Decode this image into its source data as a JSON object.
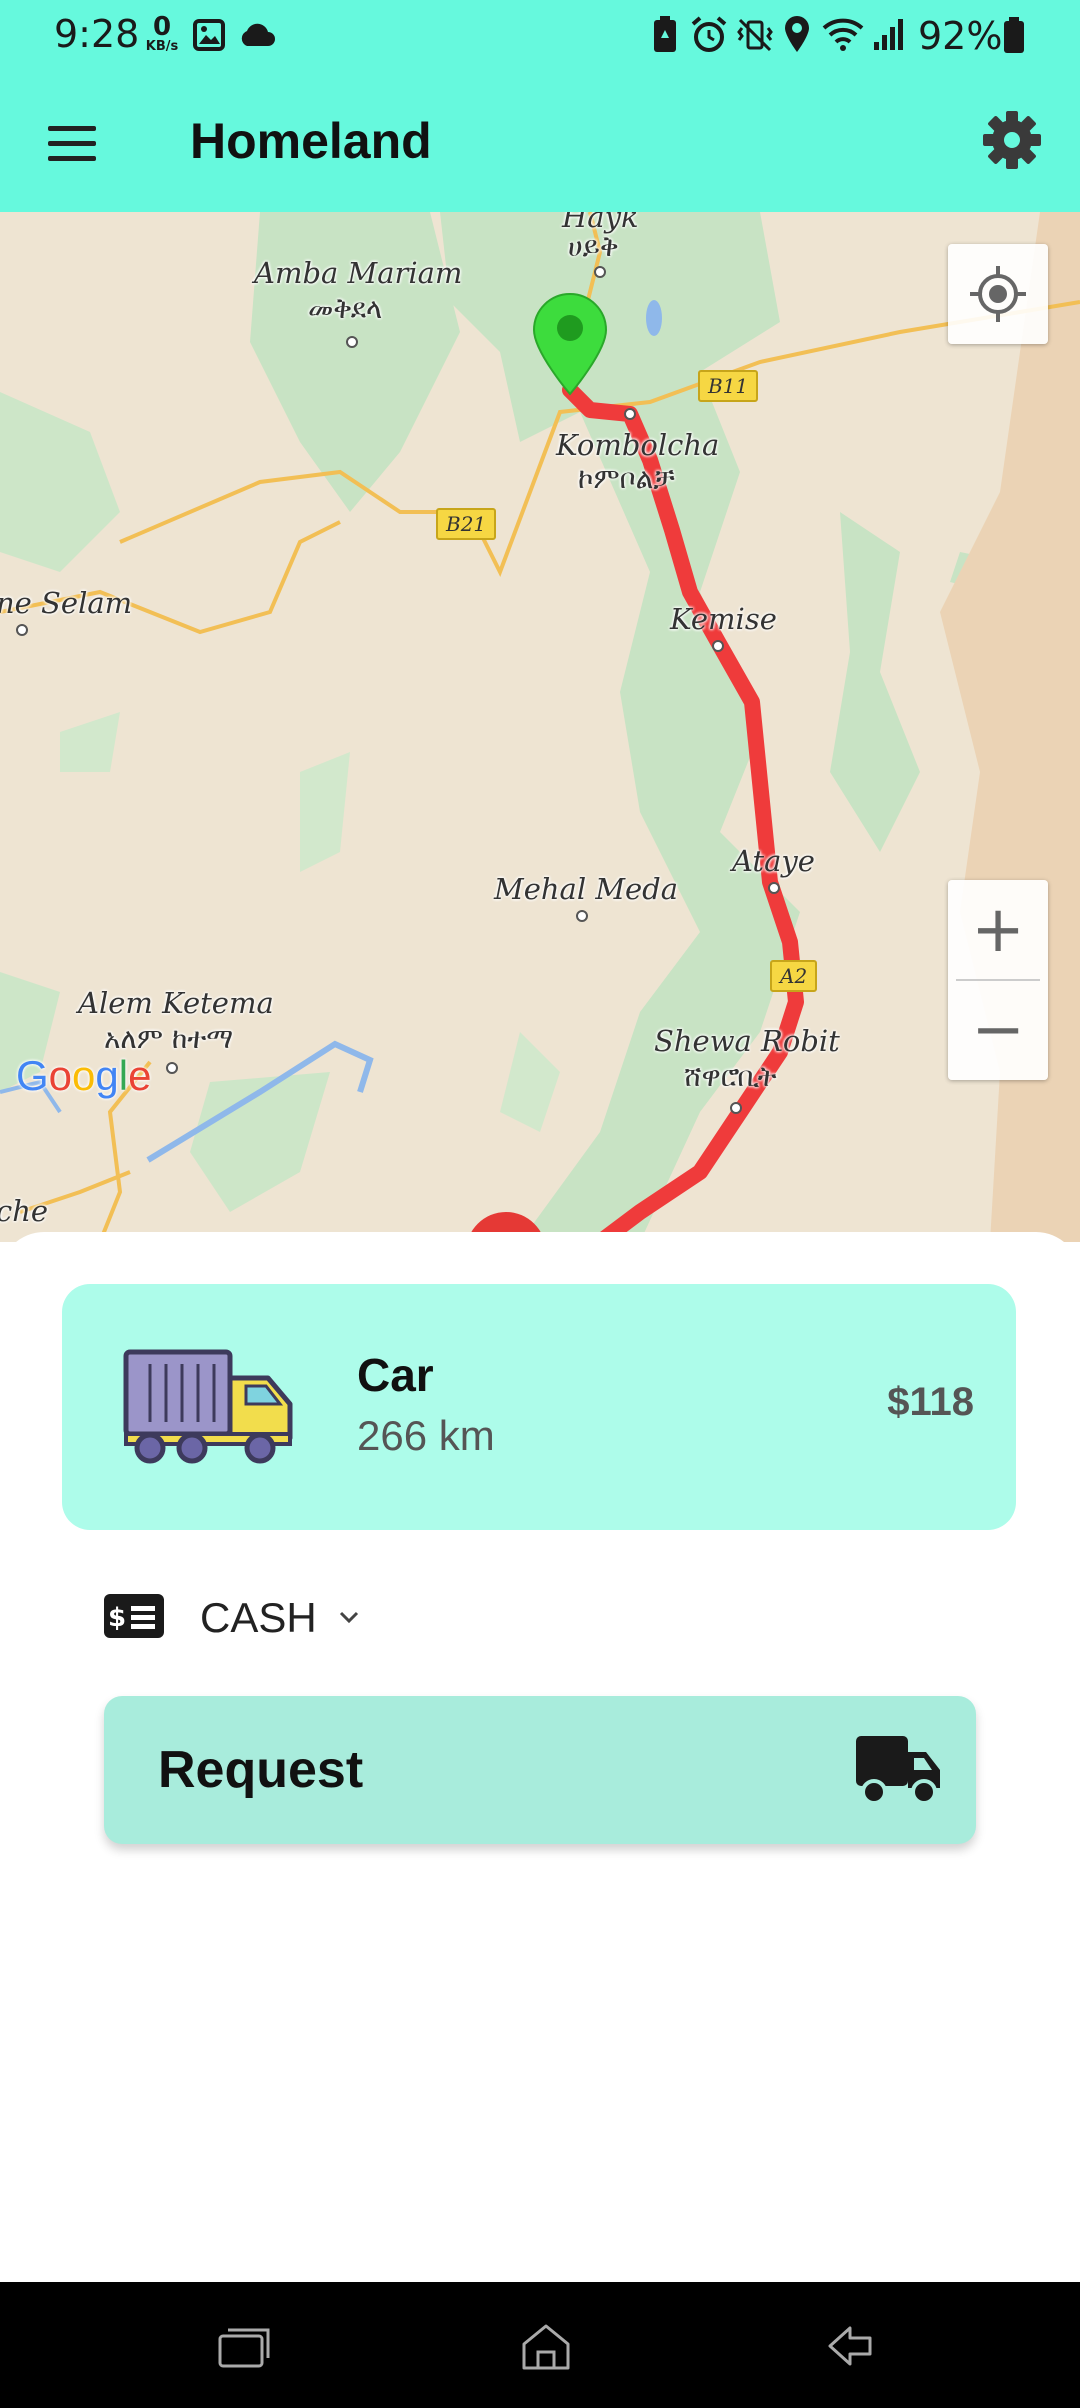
{
  "status_bar": {
    "time": "9:28",
    "net_speed_value": "0",
    "net_speed_unit": "KB/s",
    "battery": "92%",
    "icons": [
      "image-icon",
      "cloud-icon",
      "battery-saver-icon",
      "alarm-icon",
      "vibrate-off-icon",
      "location-icon",
      "wifi-icon",
      "signal-icon",
      "battery-icon"
    ]
  },
  "app_bar": {
    "title": "Homeland"
  },
  "map": {
    "labels": {
      "hayk": "Hayk",
      "hayk_am": "ሀይቅ",
      "amba_mariam": "Amba Mariam",
      "amba_mariam_am": "መቅደላ",
      "kombolcha": "Kombolcha",
      "kombolcha_am": "ኮምቦልቻ",
      "selam": "ne Selam",
      "kemise": "Kemise",
      "mehal_meda": "Mehal Meda",
      "ataye": "Ataye",
      "alem_ketema": "Alem Ketema",
      "alem_ketema_am": "አለም ከተማ",
      "shewa_robit": "Shewa Robit",
      "shewa_robit_am": "ሸዋሮቢት",
      "che": "che"
    },
    "road_shields": {
      "b11": "B11",
      "b21": "B21",
      "a2": "A2"
    },
    "attribution": "Google",
    "zoom_in": "+",
    "zoom_out": "−",
    "route_color": "#ef3b3b",
    "origin_marker_color": "#3ddc3d"
  },
  "booking": {
    "vehicle": {
      "name": "Car",
      "distance": "266 km",
      "price": "$118"
    },
    "payment": {
      "method": "CASH"
    },
    "request_label": "Request"
  },
  "colors": {
    "accent": "#66f9dd",
    "card": "#adfcea",
    "button": "#a8ecdc"
  }
}
